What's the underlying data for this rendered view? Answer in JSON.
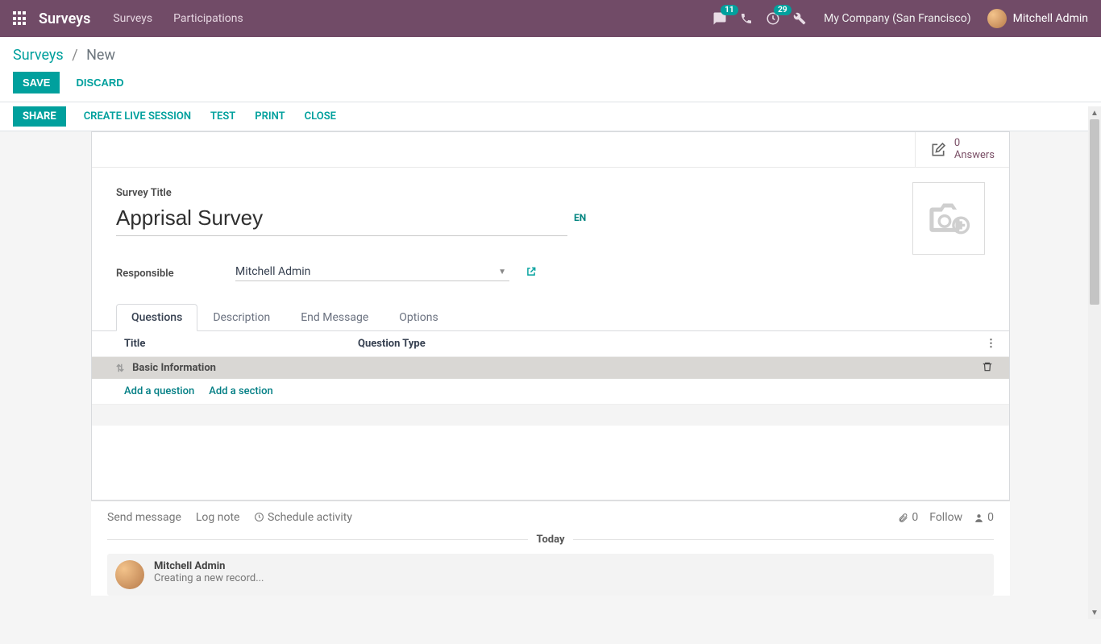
{
  "navbar": {
    "brand": "Surveys",
    "links": {
      "surveys": "Surveys",
      "participations": "Participations"
    },
    "badges": {
      "messages": "11",
      "activities": "29"
    },
    "company": "My Company (San Francisco)",
    "user": "Mitchell Admin"
  },
  "breadcrumb": {
    "root": "Surveys",
    "leaf": "New"
  },
  "buttons": {
    "save": "SAVE",
    "discard": "DISCARD",
    "share": "SHARE",
    "create_live": "CREATE LIVE SESSION",
    "test": "TEST",
    "print": "PRINT",
    "close": "CLOSE"
  },
  "stat": {
    "count": "0",
    "label": "Answers"
  },
  "form": {
    "title_label": "Survey Title",
    "title_value": "Apprisal Survey",
    "lang": "EN",
    "responsible_label": "Responsible",
    "responsible_value": "Mitchell Admin"
  },
  "tabs": {
    "questions": "Questions",
    "description": "Description",
    "end_message": "End Message",
    "options": "Options"
  },
  "qtable": {
    "col_title": "Title",
    "col_type": "Question Type",
    "section": "Basic Information",
    "add_question": "Add a question",
    "add_section": "Add a section"
  },
  "chatter": {
    "send_message": "Send message",
    "log_note": "Log note",
    "schedule": "Schedule activity",
    "attach_count": "0",
    "follow": "Follow",
    "followers": "0",
    "today": "Today",
    "log_user": "Mitchell Admin",
    "log_text": "Creating a new record..."
  }
}
